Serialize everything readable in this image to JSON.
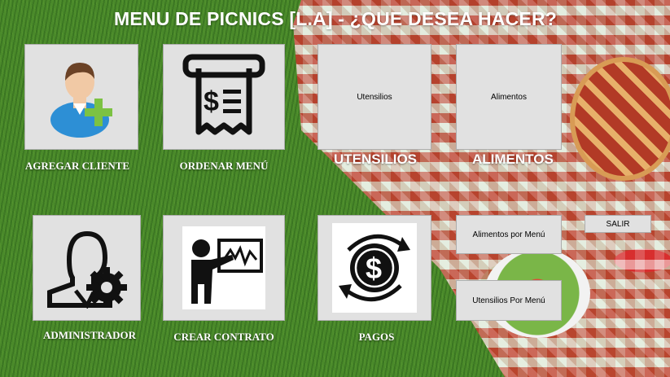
{
  "window": {
    "title": "MENU DE PICNICS [L.A] - ¿QUE DESEA HACER?"
  },
  "tiles": {
    "agregar_cliente": {
      "caption": "AGREGAR CLIENTE",
      "icon": "user-add-icon"
    },
    "ordenar_menu": {
      "caption": "ORDENAR MENÚ",
      "icon": "receipt-dollar-icon"
    },
    "utensilios": {
      "button_label": "Utensilios",
      "caption": "UTENSILIOS"
    },
    "alimentos": {
      "button_label": "Alimentos",
      "caption": "ALIMENTOS"
    },
    "administrador": {
      "caption": "ADMINISTRADOR",
      "icon": "admin-gear-icon"
    },
    "crear_contrato": {
      "caption": "CREAR CONTRATO",
      "icon": "presentation-icon"
    },
    "pagos": {
      "caption": "PAGOS",
      "icon": "dollar-cycle-icon"
    }
  },
  "buttons": {
    "alimentos_por_menu": "Alimentos por Menú",
    "utensilios_por_menu": "Utensilios Por Menú",
    "salir": "SALIR"
  },
  "colors": {
    "tile_bg": "#e1e1e1",
    "tile_border": "#adadad",
    "title_text": "#ffffff",
    "plus_green": "#7cc242",
    "shirt_blue": "#2d8fd5"
  }
}
